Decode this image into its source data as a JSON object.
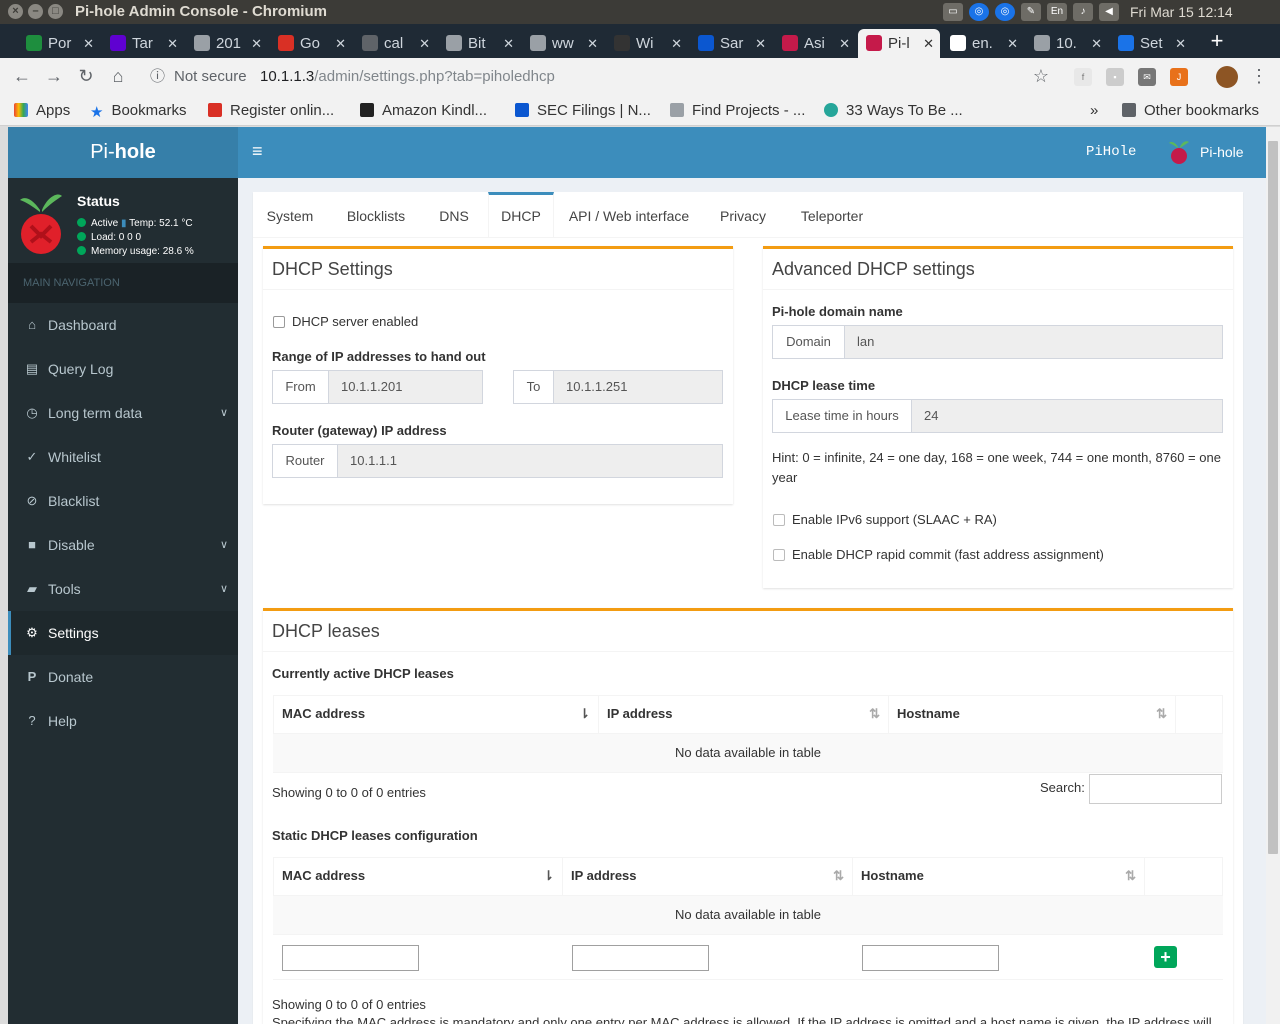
{
  "window": {
    "title": "Pi-hole Admin Console - Chromium"
  },
  "tray": {
    "datetime": "Fri Mar 15  12:14",
    "lang": "En"
  },
  "tabs": [
    {
      "label": "Por",
      "color": "#1e8e3e"
    },
    {
      "label": "Tar",
      "color": "#5f01d1"
    },
    {
      "label": "201",
      "color": "#9aa0a6"
    },
    {
      "label": "Go",
      "color": "#d93025"
    },
    {
      "label": "cal",
      "color": "#5f6368"
    },
    {
      "label": "Bit",
      "color": "#9aa0a6"
    },
    {
      "label": "ww",
      "color": "#9aa0a6"
    },
    {
      "label": "Wi",
      "color": "#333333"
    },
    {
      "label": "Sar",
      "color": "#0b57d0"
    },
    {
      "label": "Asi",
      "color": "#c51a4a"
    },
    {
      "label": "Pi-l",
      "color": "#c51a4a"
    },
    {
      "label": "en.",
      "color": "#ffffff"
    },
    {
      "label": "10.",
      "color": "#9aa0a6"
    },
    {
      "label": "Set",
      "color": "#1a73e8"
    }
  ],
  "address": {
    "info_icon": "info-icon",
    "not_secure": "Not secure",
    "host": "10.1.1.3",
    "path": "/admin/settings.php?tab=piholedhcp"
  },
  "bookmarks": {
    "items": [
      "Apps",
      "Bookmarks",
      "Register onlin...",
      "Amazon Kindl...",
      "SEC Filings | N...",
      "Find Projects - ...",
      "33 Ways To Be ..."
    ],
    "overflow": "»",
    "other": "Other bookmarks"
  },
  "sidebar": {
    "logo_pre": "Pi-",
    "logo_bold": "hole",
    "status_title": "Status",
    "status_active": "Active",
    "status_temp": "Temp: 52.1 °C",
    "status_load": "Load:  0  0  0",
    "status_memory": "Memory usage:  28.6 %",
    "nav_header": "MAIN NAVIGATION",
    "items": [
      {
        "label": "Dashboard",
        "icon": "home-icon"
      },
      {
        "label": "Query Log",
        "icon": "file-icon"
      },
      {
        "label": "Long term data",
        "icon": "clock-icon"
      },
      {
        "label": "Whitelist",
        "icon": "check-circle-icon"
      },
      {
        "label": "Blacklist",
        "icon": "ban-icon"
      },
      {
        "label": "Disable",
        "icon": "stop-icon"
      },
      {
        "label": "Tools",
        "icon": "folder-icon"
      },
      {
        "label": "Settings",
        "icon": "gears-icon"
      },
      {
        "label": "Donate",
        "icon": "paypal-icon"
      },
      {
        "label": "Help",
        "icon": "question-icon"
      }
    ]
  },
  "header": {
    "hostname": "PiHole",
    "user": "Pi-hole"
  },
  "settings_tabs": [
    "System",
    "Blocklists",
    "DNS",
    "DHCP",
    "API / Web interface",
    "Privacy",
    "Teleporter"
  ],
  "dhcp_settings": {
    "title": "DHCP Settings",
    "server_enabled": "DHCP server enabled",
    "range_label": "Range of IP addresses to hand out",
    "from_addon": "From",
    "from_value": "10.1.1.201",
    "to_addon": "To",
    "to_value": "10.1.1.251",
    "router_label": "Router (gateway) IP address",
    "router_addon": "Router",
    "router_value": "10.1.1.1"
  },
  "advanced": {
    "title": "Advanced DHCP settings",
    "domain_label": "Pi-hole domain name",
    "domain_addon": "Domain",
    "domain_value": "lan",
    "lease_label": "DHCP lease time",
    "lease_addon": "Lease time in hours",
    "lease_value": "24",
    "hint": "Hint: 0 = infinite, 24 = one day, 168 = one week, 744 = one month, 8760 = one year",
    "ipv6": "Enable IPv6 support (SLAAC + RA)",
    "rapid": "Enable DHCP rapid commit (fast address assignment)"
  },
  "leases": {
    "title": "DHCP leases",
    "active_label": "Currently active DHCP leases",
    "col_mac": "MAC address",
    "col_ip": "IP address",
    "col_host": "Hostname",
    "no_data": "No data available in table",
    "showing": "Showing 0 to 0 of 0 entries",
    "search_label": "Search:",
    "static_label": "Static DHCP leases configuration",
    "static_no_data": "No data available in table",
    "add_symbol": "+",
    "static_showing": "Showing 0 to 0 of 0 entries",
    "footnote": "Specifying the MAC address is mandatory and only one entry per MAC address is allowed. If the IP address is omitted and a host name is given, the IP address will"
  }
}
